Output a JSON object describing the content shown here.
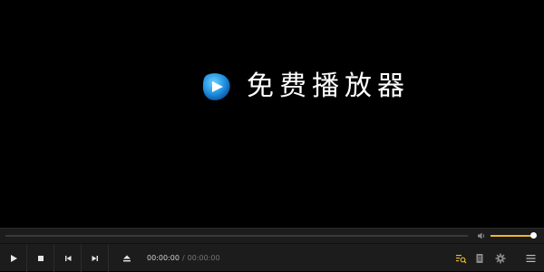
{
  "logo": {
    "title": "免费播放器",
    "icon": "play-logo-icon"
  },
  "colors": {
    "background": "#000000",
    "control_bar": "#1c1c1c",
    "accent": "#e8b92c",
    "logo_blue": "#1e8fe0"
  },
  "seek": {
    "progress": 0
  },
  "volume": {
    "icon": "speaker-icon",
    "level": 1.0
  },
  "controls": {
    "play_icon": "play-icon",
    "stop_icon": "stop-icon",
    "prev_icon": "previous-icon",
    "next_icon": "next-icon",
    "eject_icon": "eject-icon"
  },
  "time": {
    "current": "00:00:00",
    "separator": "/",
    "total": "00:00:00"
  },
  "right_controls": {
    "playlist_search_icon": "playlist-search-icon",
    "document_icon": "document-icon",
    "settings_icon": "gear-icon",
    "menu_icon": "hamburger-menu-icon"
  }
}
